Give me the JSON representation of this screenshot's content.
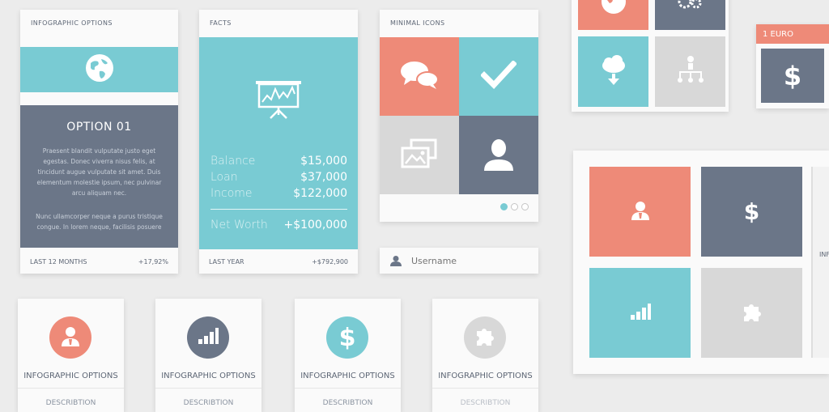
{
  "colors": {
    "teal": "#79cbd3",
    "coral": "#ee8a78",
    "slate": "#6b7688",
    "light_gray": "#d8d8d8",
    "background": "#ececec"
  },
  "option_card": {
    "header": "INFOGRAPHIC OPTIONS",
    "icon": "globe-icon",
    "title": "OPTION 01",
    "body_1": "Praesent blandit vulputate justo eget egestas. Donec viverra nisus felis, at tincidunt augue vulputate sit amet. Duis elementum molestie ipsum, nec pulvinar arcu aliquam nec.",
    "body_2": "Nunc ullamcorper neque a purus tristique congue. In lorem neque, facilisis posuere",
    "footer_label": "LAST 12 MONTHS",
    "footer_value": "+17,92%"
  },
  "facts_card": {
    "header": "FACTS",
    "icon": "presentation-chart-icon",
    "rows": [
      {
        "label": "Balance",
        "value": "$15,000"
      },
      {
        "label": "Loan",
        "value": "$37,000"
      },
      {
        "label": "Income",
        "value": "$122,000"
      }
    ],
    "net_label": "Net Worth",
    "net_value": "+$100,000",
    "footer_label": "LAST YEAR",
    "footer_value": "+$792,900"
  },
  "icons_card": {
    "header": "MINIMAL ICONS",
    "tiles": [
      "chat-bubbles-icon",
      "checkmark-icon",
      "image-gallery-icon",
      "user-silhouette-icon"
    ],
    "pagination_active": 1,
    "pagination_total": 3
  },
  "username_field": {
    "placeholder": "Username",
    "icon": "user-icon"
  },
  "bottom_cards": [
    {
      "title": "INFOGRAPHIC OPTIONS",
      "description": "DESCRIBTION",
      "icon": "businessman-icon",
      "color": "#ee8a78"
    },
    {
      "title": "INFOGRAPHIC OPTIONS",
      "description": "DESCRIBTION",
      "icon": "bar-chart-icon",
      "color": "#6b7688"
    },
    {
      "title": "INFOGRAPHIC OPTIONS",
      "description": "DESCRIBTION",
      "icon": "dollar-icon",
      "color": "#79cbd3"
    },
    {
      "title": "INFOGRAPHIC OPTIONS",
      "description": "DESCRIBTION",
      "icon": "puzzle-icon",
      "color": "#d8d8d8"
    }
  ],
  "top_right_grid": {
    "tiles": [
      "globe-icon",
      "gears-icon",
      "cloud-download-icon",
      "network-icon"
    ]
  },
  "euro_card": {
    "label": "1 EURO",
    "symbol": "$",
    "icon": "dollar-icon"
  },
  "big_grid": {
    "tiles": [
      "businessman-icon",
      "dollar-icon",
      "bar-chart-icon",
      "puzzle-icon"
    ],
    "dollar_symbol": "$",
    "side_text": "INF"
  }
}
